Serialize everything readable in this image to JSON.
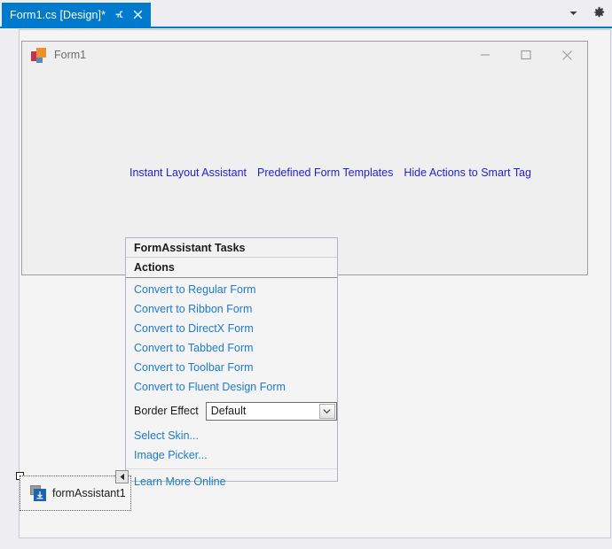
{
  "tab": {
    "title": "Form1.cs [Design]*",
    "pin_icon": "pin-icon",
    "close_icon": "close-icon"
  },
  "strip_controls": {
    "dropdown_icon": "chevron-down-icon",
    "settings_icon": "gear-icon"
  },
  "form_window": {
    "title": "Form1",
    "icon": "form-designer-icon",
    "minimize_icon": "minimize-icon",
    "maximize_icon": "maximize-icon",
    "close_icon": "close-icon"
  },
  "smart_links": [
    {
      "label": "Instant Layout Assistant"
    },
    {
      "label": "Predefined Form Templates"
    },
    {
      "label": "Hide Actions to Smart Tag"
    }
  ],
  "tasks_panel": {
    "header": "FormAssistant Tasks",
    "subheader": "Actions",
    "actions": [
      {
        "label": "Convert to Regular Form"
      },
      {
        "label": "Convert to Ribbon Form"
      },
      {
        "label": "Convert to DirectX Form"
      },
      {
        "label": "Convert to Tabbed Form"
      },
      {
        "label": "Convert to Toolbar Form"
      },
      {
        "label": "Convert to Fluent Design Form"
      }
    ],
    "border_effect": {
      "label": "Border Effect",
      "value": "Default",
      "dropdown_icon": "chevron-down-icon"
    },
    "secondary_links": [
      {
        "label": "Select Skin..."
      },
      {
        "label": "Image Picker..."
      }
    ],
    "footer_link": {
      "label": "Learn More Online"
    }
  },
  "tray": {
    "item_label": "formAssistant1",
    "item_icon": "form-assistant-component-icon",
    "collapse_icon": "collapse-left-icon",
    "selection_handle": "selection-handle"
  },
  "colors": {
    "tab_accent": "#007acc",
    "link_blue": "#1e7bc8",
    "smart_link_blue": "#2222cc",
    "surface": "#f4f4f4",
    "window_chrome": "#eeeef2"
  }
}
